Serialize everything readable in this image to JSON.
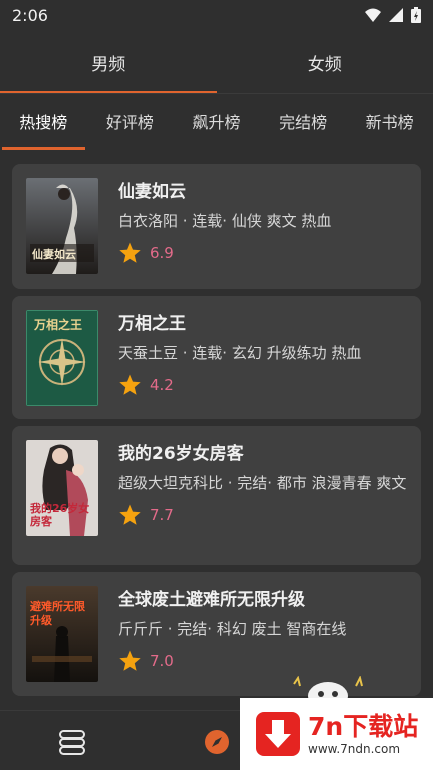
{
  "status": {
    "time": "2:06"
  },
  "gender_tabs": [
    {
      "label": "男频",
      "active": true
    },
    {
      "label": "女频",
      "active": false
    }
  ],
  "rank_tabs": [
    {
      "label": "热搜榜",
      "active": true
    },
    {
      "label": "好评榜",
      "active": false
    },
    {
      "label": "飙升榜",
      "active": false
    },
    {
      "label": "完结榜",
      "active": false
    },
    {
      "label": "新书榜",
      "active": false
    }
  ],
  "books": [
    {
      "title": "仙妻如云",
      "meta": "白衣洛阳 · 连载· 仙侠 爽文 热血",
      "score": "6.9",
      "cover_text": "仙妻如云"
    },
    {
      "title": "万相之王",
      "meta": "天蚕土豆 · 连载· 玄幻 升级练功 热血",
      "score": "4.2",
      "cover_text": "万相之王"
    },
    {
      "title": "我的26岁女房客",
      "meta": "超级大坦克科比 · 完结· 都市 浪漫青春 爽文",
      "score": "7.7",
      "cover_text": "我的26岁女房客"
    },
    {
      "title": "全球废土避难所无限升级",
      "meta": "斤斤斤 · 完结· 科幻 废土 智商在线",
      "score": "7.0",
      "cover_text": "避难所无限升级"
    }
  ],
  "watermark": {
    "name": "7n下载站",
    "url": "www.7ndn.com"
  },
  "colors": {
    "accent": "#e0642e",
    "score": "#e36b8a",
    "star": "#f5a20f",
    "card": "#404040",
    "background": "#2f2f2f"
  }
}
